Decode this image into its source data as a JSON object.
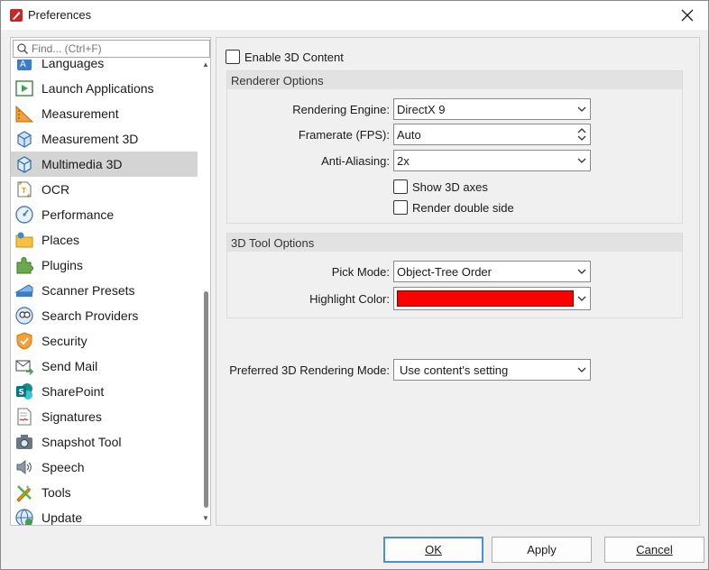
{
  "window": {
    "title": "Preferences",
    "close_glyph": "✕"
  },
  "sidebar": {
    "search_placeholder": "Find... (Ctrl+F)",
    "items": [
      {
        "label": "Languages",
        "icon": "languages-icon"
      },
      {
        "label": "Launch Applications",
        "icon": "launch-applications-icon"
      },
      {
        "label": "Measurement",
        "icon": "measurement-icon"
      },
      {
        "label": "Measurement 3D",
        "icon": "measurement-3d-icon"
      },
      {
        "label": "Multimedia 3D",
        "icon": "multimedia-3d-icon",
        "selected": true
      },
      {
        "label": "OCR",
        "icon": "ocr-icon"
      },
      {
        "label": "Performance",
        "icon": "performance-icon"
      },
      {
        "label": "Places",
        "icon": "places-icon"
      },
      {
        "label": "Plugins",
        "icon": "plugins-icon"
      },
      {
        "label": "Scanner Presets",
        "icon": "scanner-presets-icon"
      },
      {
        "label": "Search Providers",
        "icon": "search-providers-icon"
      },
      {
        "label": "Security",
        "icon": "security-icon"
      },
      {
        "label": "Send Mail",
        "icon": "send-mail-icon"
      },
      {
        "label": "SharePoint",
        "icon": "sharepoint-icon"
      },
      {
        "label": "Signatures",
        "icon": "signatures-icon"
      },
      {
        "label": "Snapshot Tool",
        "icon": "snapshot-tool-icon"
      },
      {
        "label": "Speech",
        "icon": "speech-icon"
      },
      {
        "label": "Tools",
        "icon": "tools-icon"
      },
      {
        "label": "Update",
        "icon": "update-icon"
      }
    ]
  },
  "content": {
    "enable_3d_label": "Enable 3D Content",
    "enable_3d_checked": false,
    "renderer_options": {
      "title": "Renderer Options",
      "rendering_engine_label": "Rendering Engine:",
      "rendering_engine_value": "DirectX 9",
      "framerate_label": "Framerate (FPS):",
      "framerate_value": "Auto",
      "anti_aliasing_label": "Anti-Aliasing:",
      "anti_aliasing_value": "2x",
      "show_axes_label": "Show 3D axes",
      "show_axes_checked": false,
      "render_double_side_label": "Render double side",
      "render_double_side_checked": false
    },
    "tool_options": {
      "title": "3D Tool Options",
      "pick_mode_label": "Pick Mode:",
      "pick_mode_value": "Object-Tree Order",
      "highlight_color_label": "Highlight Color:",
      "highlight_color": "#ff0000"
    },
    "preferred_mode_label": "Preferred 3D Rendering Mode:",
    "preferred_mode_value": "Use content's setting"
  },
  "buttons": {
    "ok": "OK",
    "apply": "Apply",
    "cancel": "Cancel"
  },
  "colors": {
    "selected_item_bg": "#d4d4d4",
    "default_button_border": "#4a90d9",
    "group_header_bg": "#e2e2e2"
  }
}
